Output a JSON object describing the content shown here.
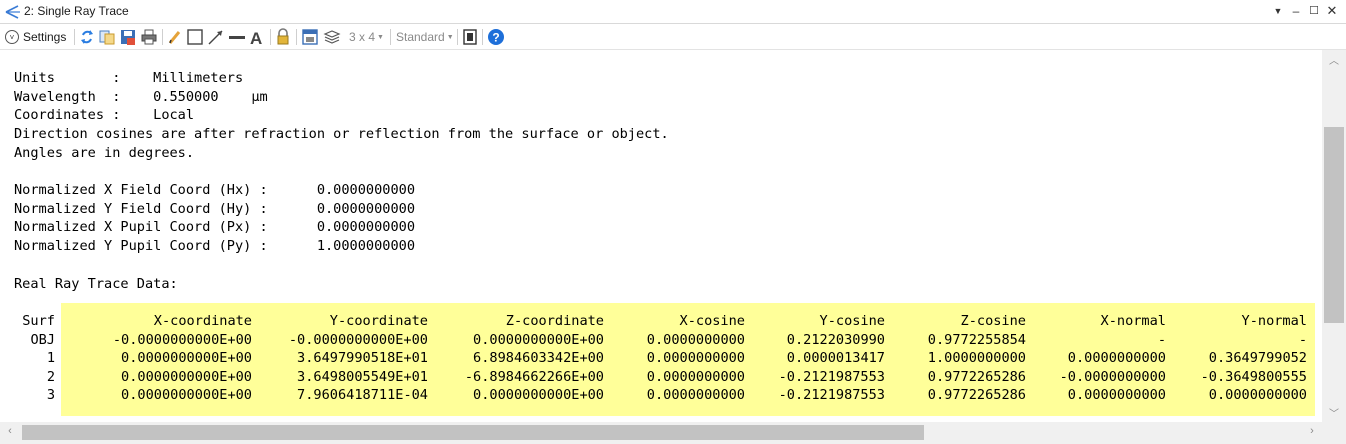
{
  "window": {
    "title": "2: Single Ray Trace"
  },
  "toolbar": {
    "settings_label": "Settings",
    "layout_value": "3 x 4",
    "style_value": "Standard"
  },
  "header_lines": [
    "Units       :    Millimeters",
    "Wavelength  :    0.550000    µm",
    "Coordinates :    Local",
    "Direction cosines are after refraction or reflection from the surface or object.",
    "Angles are in degrees.",
    "",
    "Normalized X Field Coord (Hx) :      0.0000000000",
    "Normalized Y Field Coord (Hy) :      0.0000000000",
    "Normalized X Pupil Coord (Px) :      0.0000000000",
    "Normalized Y Pupil Coord (Py) :      1.0000000000",
    "",
    "Real Ray Trace Data:"
  ],
  "table": {
    "columns": [
      "Surf",
      "X-coordinate",
      "Y-coordinate",
      "Z-coordinate",
      "X-cosine",
      "Y-cosine",
      "Z-cosine",
      "X-normal",
      "Y-normal"
    ],
    "rows": [
      [
        "OBJ",
        "-0.0000000000E+00",
        "-0.0000000000E+00",
        "0.0000000000E+00",
        "0.0000000000",
        "0.2122030990",
        "0.9772255854",
        "-",
        "-"
      ],
      [
        "1",
        "0.0000000000E+00",
        "3.6497990518E+01",
        "6.8984603342E+00",
        "0.0000000000",
        "0.0000013417",
        "1.0000000000",
        "0.0000000000",
        "0.3649799052"
      ],
      [
        "2",
        "0.0000000000E+00",
        "3.6498005549E+01",
        "-6.8984662266E+00",
        "0.0000000000",
        "-0.2121987553",
        "0.9772265286",
        "-0.0000000000",
        "-0.3649800555"
      ],
      [
        "3",
        "0.0000000000E+00",
        "7.9606418711E-04",
        "0.0000000000E+00",
        "0.0000000000",
        "-0.2121987553",
        "0.9772265286",
        "0.0000000000",
        "0.0000000000"
      ]
    ]
  },
  "colors": {
    "highlight": "#ffff99",
    "accent": "#1e6fd9"
  }
}
